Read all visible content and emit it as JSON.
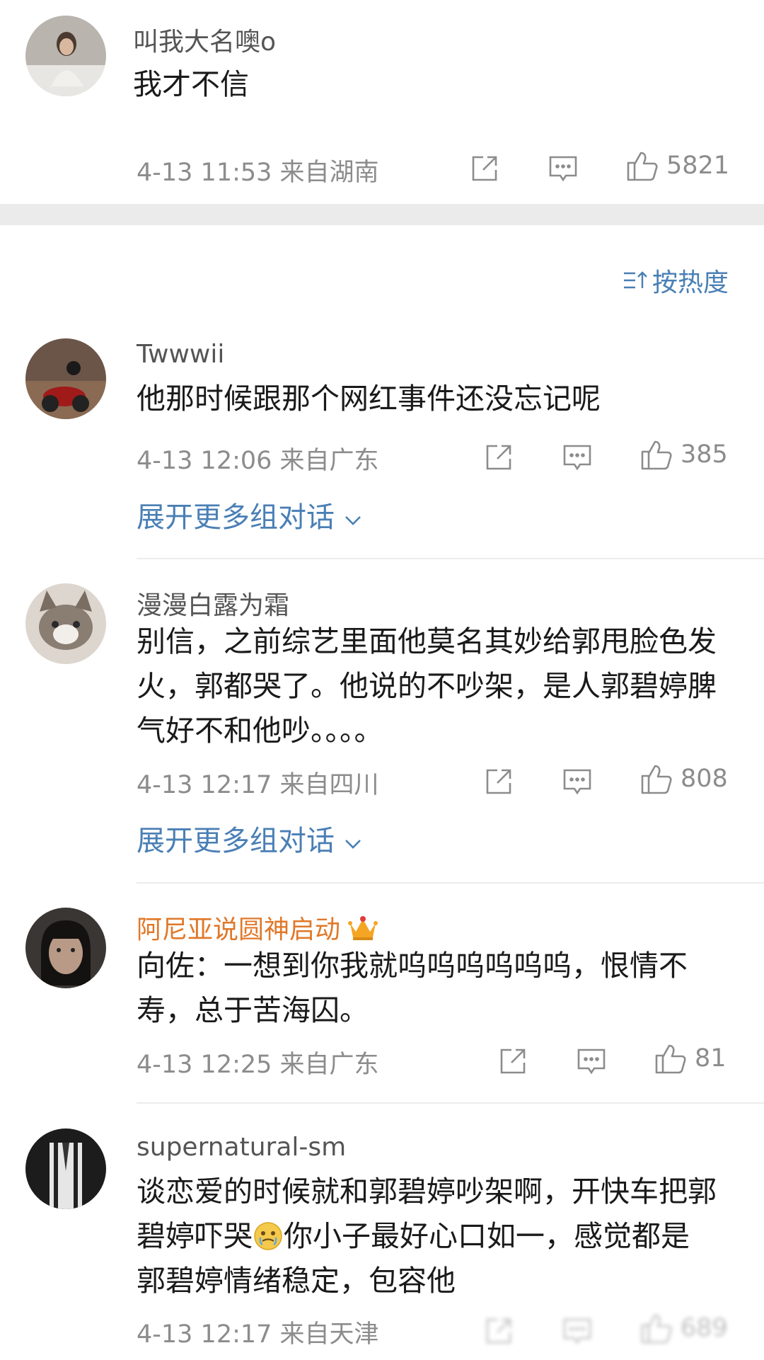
{
  "top_comment": {
    "username": "叫我大名噢o",
    "text": "我才不信",
    "meta": "4-13 11:53 来自湖南",
    "likes": "5821"
  },
  "sort_label": "按热度",
  "comments": [
    {
      "username": "Twwwii",
      "text": "他那时候跟那个网红事件还没忘记呢",
      "meta": "4-13 12:06 来自广东",
      "likes": "385",
      "expand": "展开更多组对话"
    },
    {
      "username": "漫漫白露为霜",
      "text": "别信，之前综艺里面他莫名其妙给郭甩脸色发火，郭都哭了。他说的不吵架，是人郭碧婷脾气好不和他吵。。。。",
      "meta": "4-13 12:17 来自四川",
      "likes": "808",
      "expand": "展开更多组对话"
    },
    {
      "username": "阿尼亚说圆神启动",
      "text": "向佐：一想到你我就呜呜呜呜呜呜，恨情不寿，总于苦海囚。",
      "meta": "4-13 12:25 来自广东",
      "likes": "81"
    },
    {
      "username": "supernatural-sm",
      "text_part1": "谈恋爱的时候就和郭碧婷吵架啊，开快车把郭碧婷吓哭",
      "text_part2": "你小子最好心口如一，感觉都是郭碧婷情绪稳定，包容他",
      "meta": "4-13 12:17 来自天津",
      "likes": "689"
    }
  ],
  "colors": {
    "link": "#4a7fb5",
    "vip_name": "#e0782a",
    "meta": "#8c8c8c"
  },
  "icons": [
    "share-icon",
    "comment-icon",
    "like-icon",
    "sort-icon",
    "chevron-down-icon",
    "vip-crown-icon",
    "emoji-icon"
  ]
}
